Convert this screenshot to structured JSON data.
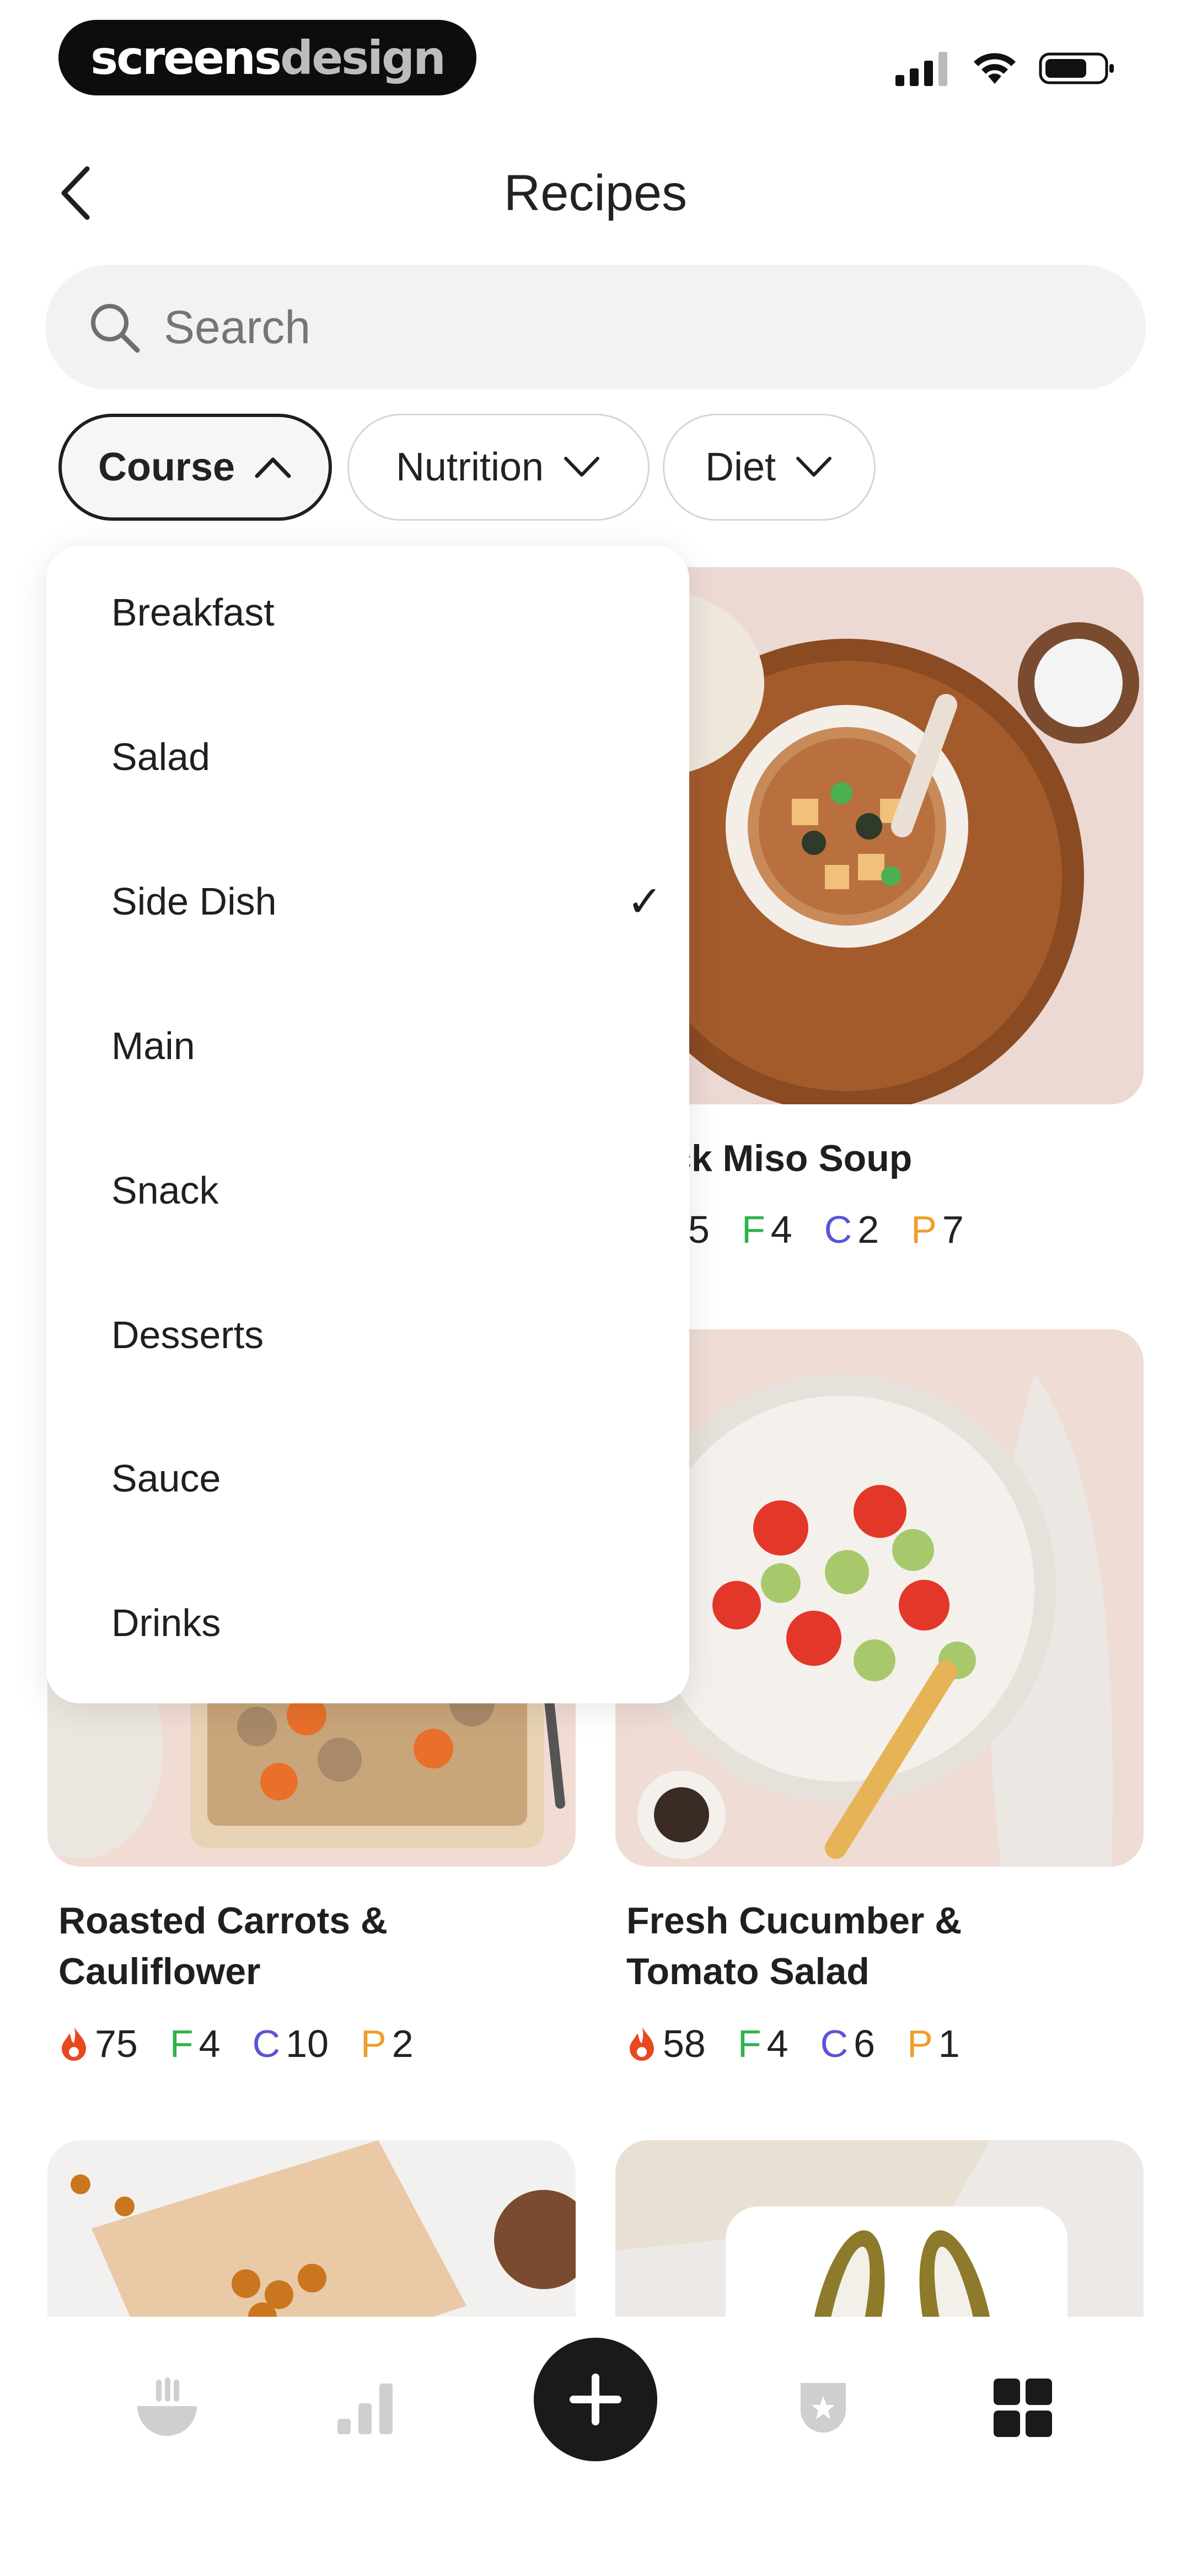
{
  "status_bar": {
    "brand_a": "screens",
    "brand_b": "design"
  },
  "header": {
    "title": "Recipes"
  },
  "search": {
    "placeholder": "Search"
  },
  "filters": [
    {
      "label": "Course",
      "expanded": true
    },
    {
      "label": "Nutrition",
      "expanded": false
    },
    {
      "label": "Diet",
      "expanded": false
    }
  ],
  "course_menu": {
    "options": [
      "Breakfast",
      "Salad",
      "Side Dish",
      "Main",
      "Snack",
      "Desserts",
      "Sauce",
      "Drinks"
    ],
    "selected": "Side Dish",
    "check": "✓"
  },
  "recipes": [
    {
      "title_visible": "ck Miso Soup",
      "kcal_visible": "5",
      "F": "4",
      "C": "2",
      "P": "7"
    },
    {
      "title": "Roasted Carrots & Cauliflower",
      "title_line1": "Roasted Carrots &",
      "title_line2": "Cauliflower",
      "kcal": "75",
      "F": "4",
      "C": "10",
      "P": "2"
    },
    {
      "title": "Fresh Cucumber & Tomato Salad",
      "title_line1": "Fresh Cucumber &",
      "title_line2": "Tomato Salad",
      "kcal": "58",
      "F": "4",
      "C": "6",
      "P": "1"
    }
  ],
  "macro_keys": {
    "F": "F",
    "C": "C",
    "P": "P"
  },
  "colors": {
    "fat": "#2fb34b",
    "carbs": "#5b54d8",
    "protein": "#ef9e2c",
    "kcal": "#e8481e",
    "accent": "#1a1a1a"
  },
  "bottom_nav": {
    "items": [
      "bowl-icon",
      "bar-chart-icon",
      "add-icon",
      "badge-icon",
      "grid-icon"
    ],
    "active": "grid-icon"
  }
}
